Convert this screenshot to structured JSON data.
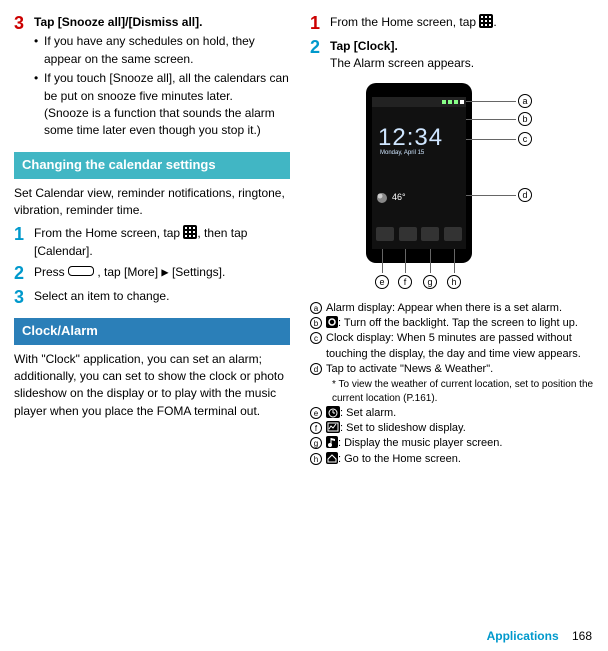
{
  "left": {
    "step3": {
      "num": "3",
      "lead": "Tap [Snooze all]/[Dismiss all].",
      "b1": "If you have any schedules on hold, they appear on the same screen.",
      "b2": "If you touch [Snooze all], all the calendars can be put on snooze five minutes later.",
      "b2_sub": "(Snooze is a function that sounds the alarm some time later even though you stop it.)"
    },
    "heading1": "Changing the calendar settings",
    "para1": "Set Calendar view, reminder notifications, ringtone, vibration, reminder time.",
    "s1": {
      "num": "1",
      "lead_a": "From the Home screen, tap ",
      "lead_b": ", then tap [Calendar]."
    },
    "s2": {
      "num": "2",
      "lead_a": "Press ",
      "lead_b": ", tap [More] ",
      "arrow": "▶",
      "lead_c": " [Settings]."
    },
    "s3": {
      "num": "3",
      "lead": "Select an item to change."
    },
    "heading2": "Clock/Alarm",
    "para2": "With \"Clock\" application, you can set an alarm; additionally, you can set to show the clock or photo slideshow on the display or to play with the music player when you place the FOMA terminal out."
  },
  "right": {
    "s1": {
      "num": "1",
      "lead_a": "From the Home screen, tap ",
      "lead_b": "."
    },
    "s2": {
      "num": "2",
      "lead": "Tap [Clock].",
      "sub": "The Alarm screen appears."
    },
    "diagram": {
      "time": "12:34",
      "date": "Monday, April 15",
      "temp": "46°",
      "labels": {
        "a": "a",
        "b": "b",
        "c": "c",
        "d": "d",
        "e": "e",
        "f": "f",
        "g": "g",
        "h": "h"
      }
    },
    "legend": {
      "a": "Alarm display: Appear when there is a set alarm.",
      "b_pre": "",
      "b_post": ": Turn off the backlight. Tap the screen to light up.",
      "c": "Clock display: When 5 minutes are passed without touching the display, the day and time view appears.",
      "d": "Tap to activate \"News & Weather\".",
      "d_note": "* To view the weather of current location, set to position the current location (P.161).",
      "e": ": Set alarm.",
      "f": ": Set to slideshow display.",
      "g": ": Display the music player screen.",
      "h": ": Go to the Home screen."
    }
  },
  "footer": {
    "section": "Applications",
    "page": "168"
  }
}
